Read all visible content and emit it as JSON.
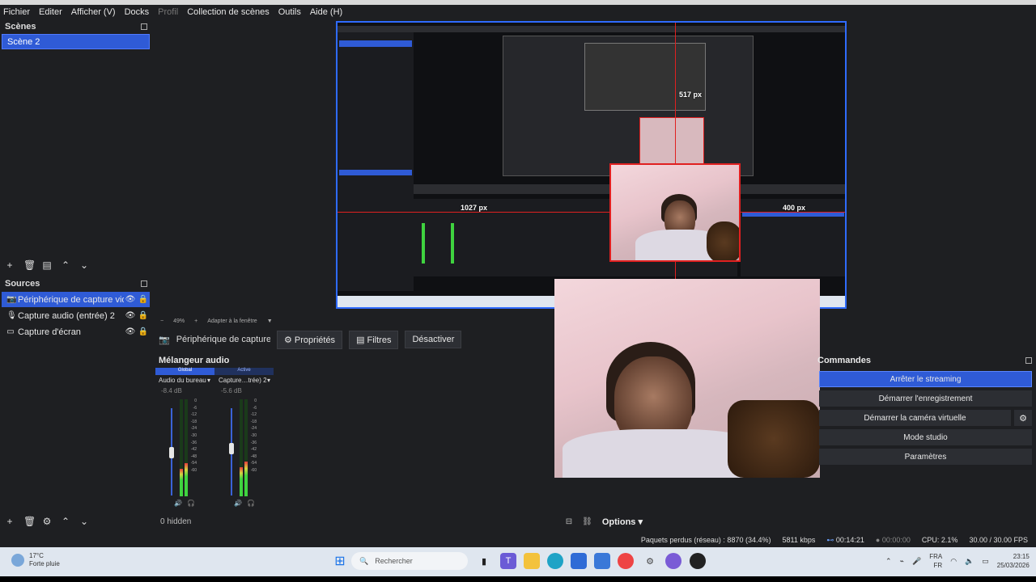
{
  "menu": [
    "Fichier",
    "Editer",
    "Afficher (V)",
    "Docks",
    "Profil",
    "Collection de scènes",
    "Outils",
    "Aide (H)"
  ],
  "menu_disabled_index": 4,
  "scenes": {
    "title": "Scènes",
    "items": [
      "Scène 2"
    ]
  },
  "sources": {
    "title": "Sources",
    "items": [
      {
        "name": "Périphérique de capture vidéo",
        "icon": "camera-icon"
      },
      {
        "name": "Capture audio (entrée) 2",
        "icon": "microphone-icon"
      },
      {
        "name": "Capture d'écran",
        "icon": "monitor-icon"
      }
    ]
  },
  "preview": {
    "px_label_top": "517 px",
    "px_label_left": "1027 px",
    "px_label_right": "400 px",
    "zoom": "49%",
    "fit_label": "Adapter à la fenêtre"
  },
  "context": {
    "source": "Périphérique de capture vi",
    "properties": "Propriétés",
    "filters": "Filtres",
    "deactivate": "Désactiver"
  },
  "mixer": {
    "title": "Mélangeur audio",
    "tabs": [
      "Global",
      "Active"
    ],
    "channels": [
      {
        "name": "Audio du bureau",
        "db": "-8.4 dB",
        "level": 0.28
      },
      {
        "name": "Capture…trée) 2",
        "db": "-5.6 dB",
        "level": 0.32
      }
    ],
    "scale": [
      "0",
      "-6",
      "-12",
      "-18",
      "-24",
      "-30",
      "-36",
      "-42",
      "-48",
      "-54",
      "-60"
    ],
    "hidden": "0 hidden",
    "options": "Options"
  },
  "commands": {
    "title": "Commandes",
    "stop_streaming": "Arrêter le streaming",
    "start_recording": "Démarrer l'enregistrement",
    "start_virtual_cam": "Démarrer la caméra virtuelle",
    "studio_mode": "Mode studio",
    "settings": "Paramètres"
  },
  "status": {
    "dropped": "Paquets perdus (réseau) : 8870 (34.4%)",
    "bitrate": "5811 kbps",
    "stream_time": "00:14:21",
    "rec_time": "00:00:00",
    "cpu": "CPU: 2.1%",
    "fps": "30.00 / 30.00 FPS"
  },
  "taskbar": {
    "temp": "17°C",
    "weather": "Forte pluie",
    "search": "Rechercher",
    "lang_top": "FRA",
    "lang_bottom": "FR",
    "time": "23:15",
    "date": "25/03/2026"
  },
  "colors": {
    "accent": "#2f5bd6",
    "guide": "#e02020",
    "background": "#1e1f22"
  }
}
